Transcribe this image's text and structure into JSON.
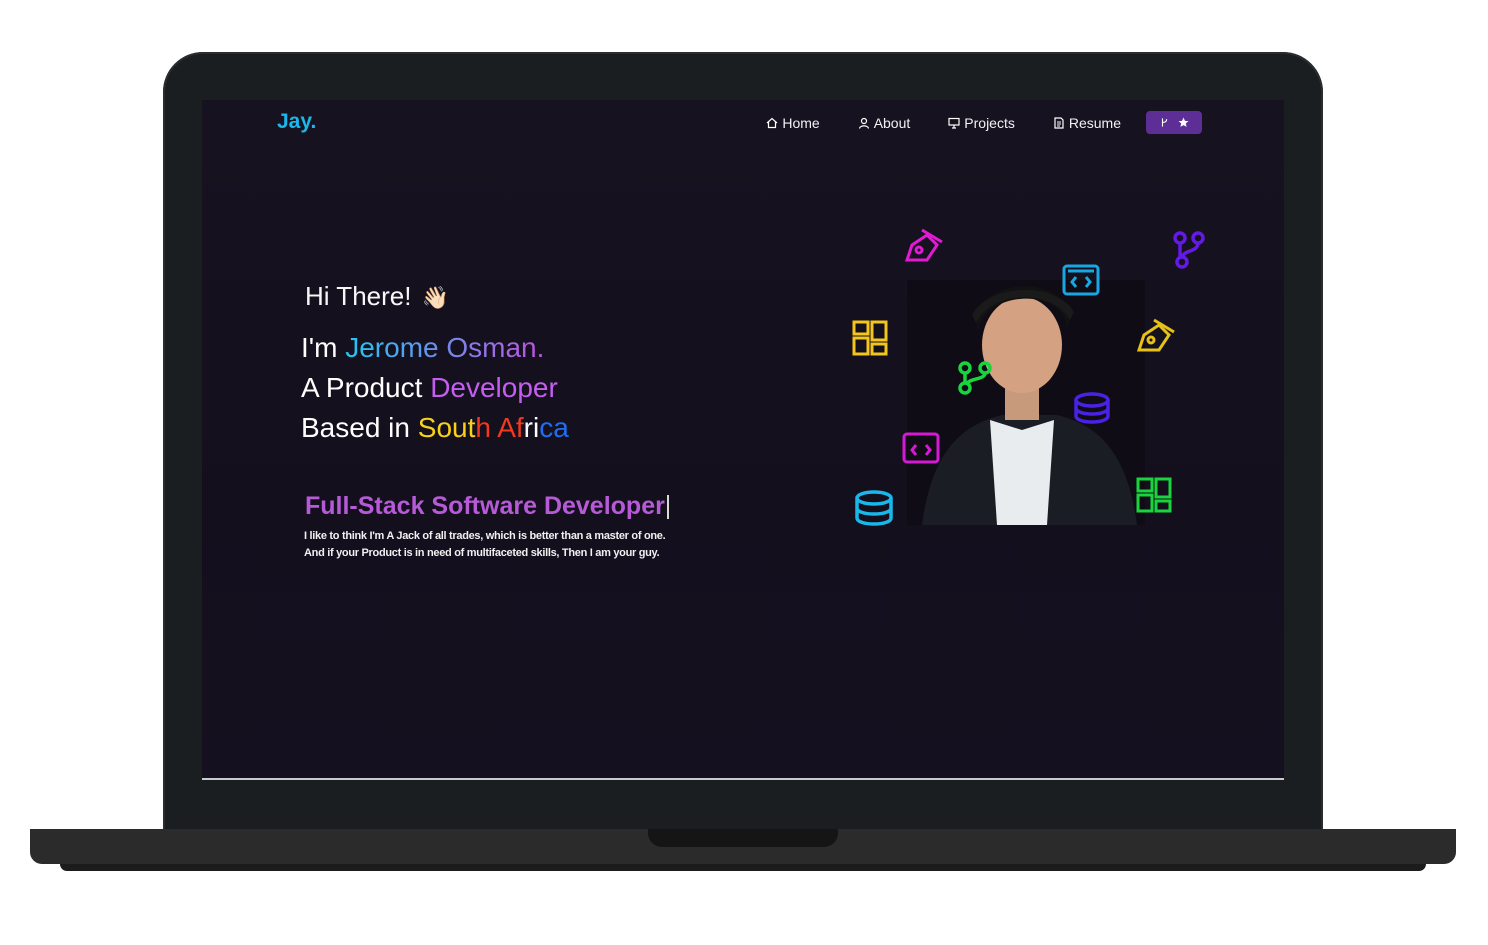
{
  "navbar": {
    "logo": "Jay.",
    "items": [
      {
        "label": "Home",
        "icon": "home-icon"
      },
      {
        "label": "About",
        "icon": "user-icon"
      },
      {
        "label": "Projects",
        "icon": "presentation-icon"
      },
      {
        "label": "Resume",
        "icon": "document-icon"
      }
    ],
    "fork_button": {
      "icons": [
        "git-fork-icon",
        "star-icon"
      ]
    }
  },
  "hero": {
    "greeting": "Hi There!",
    "wave_emoji": "👋🏻",
    "line1_prefix": "I'm ",
    "name": "Jerome Osman.",
    "line2_prefix": "A Product ",
    "line2_highlight": "Developer",
    "line3_prefix": "Based in ",
    "country_letters": [
      {
        "ch": "S",
        "color": "#f7d11b"
      },
      {
        "ch": "o",
        "color": "#f7d11b"
      },
      {
        "ch": "u",
        "color": "#f7d11b"
      },
      {
        "ch": "t",
        "color": "#f7d11b"
      },
      {
        "ch": "h",
        "color": "#ef3a1f"
      },
      {
        "ch": " ",
        "color": "#ffffff"
      },
      {
        "ch": "A",
        "color": "#ef3a1f"
      },
      {
        "ch": "f",
        "color": "#ef3a1f"
      },
      {
        "ch": "r",
        "color": "#ffffff"
      },
      {
        "ch": "i",
        "color": "#ffffff"
      },
      {
        "ch": "c",
        "color": "#1f6ef2"
      },
      {
        "ch": "a",
        "color": "#1f6ef2"
      }
    ],
    "role": "Full-Stack Software Developer",
    "bio_line1": "I like to think I'm A Jack of all trades, which is better than a master of one.",
    "bio_line2": "And if your Product is in need of multifaceted skills, Then I am your guy."
  },
  "colors": {
    "accent": "#19b7ea",
    "purple": "#c55ef0",
    "background": "#15111e"
  }
}
